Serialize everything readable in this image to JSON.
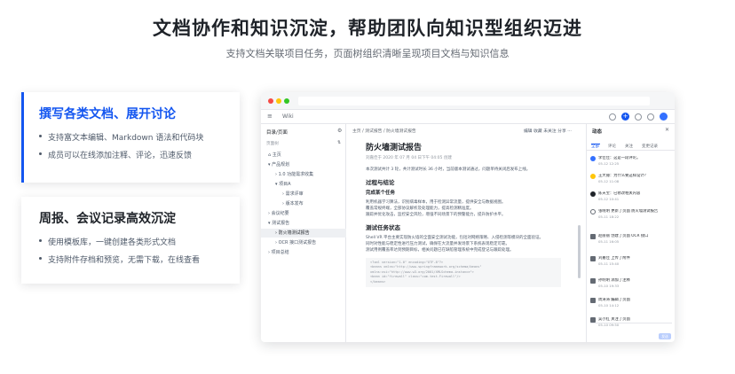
{
  "hero": {
    "title": "文档协作和知识沉淀，帮助团队向知识型组织迈进",
    "subtitle": "支持文档关联项目任务，页面树组织清晰呈现项目文档与知识信息"
  },
  "features": [
    {
      "title": "撰写各类文档、展开讨论",
      "items": [
        "支持富文本编辑、Markdown 语法和代码块",
        "成员可以在线添加注释、评论，迅速反馈"
      ]
    },
    {
      "title": "周报、会议记录高效沉淀",
      "items": [
        "使用模板库，一键创建各类形式文档",
        "支持附件存档和预览，无需下载，在线查看"
      ]
    }
  ],
  "app": {
    "title": "Wiki",
    "tree_header": "目录/页面",
    "tree_label": "页面树",
    "tree": [
      "主页",
      "产品规划",
      "1.0 功能需求收集",
      "项目A",
      "需求评审",
      "版本发布",
      "会议纪要",
      "测试报告",
      "防火墙测试报告",
      "OCR 接口测试报告",
      "项目总结"
    ],
    "breadcrumb": "主页 / 测试报告 / 防火墙测试报告",
    "doc_actions": "编辑  收藏  未关注  分享  ···",
    "doc": {
      "title": "防火墙测试报告",
      "meta": "刘嘉佳于 2020 年 07 月 04 日下午 04:05 创建",
      "intro": "本次测试共计 3 轮，共计测试时长 36 小时，当前版本测试通过，问题单待关闭后发布上线。",
      "h2a": "过程与结论",
      "h3": "完成某个任务",
      "p1": "利用机器学习算法，识别病毒样本，用于检测异常流量，提供安全与数据视图。",
      "p2": "覆盖常规终端，全部协议解析及处理能力，提高检测精准度。",
      "p3": "跟踪并优化攻击，监控安全风险，增强不同场景下的预警能力，提升防护水平。",
      "h2b": "测试任务状态",
      "p4": "Shell VR 平台主要实现防火墙的全面安全测试功能，包括对网络策略、入侵检测等模块的全面验证。",
      "p5": "同时对性能与稳定性进行压力测试，确保在大流量并发场景下系统表现稳定可靠。",
      "p6": "测试用例覆盖率达到预期目标，相关问题已在缺陷管理系统中完成登记与跟踪处理。",
      "code": [
        "<?xml version=\"1.0\" encoding=\"UTF-8\"?>",
        "<beans xmlns=\"http://www.springframework.org/schema/beans\"",
        "  xmlns:xsi=\"http://www.w3.org/2001/XMLSchema-instance\">",
        "  <bean id=\"firewall\" class=\"com.test.Firewall\"/>",
        "</beans>"
      ]
    },
    "panel": {
      "title": "动态",
      "tabs": [
        "全部",
        "评论",
        "关注",
        "变更记录"
      ],
      "entries": [
        {
          "text": "李佳佳：这是一段评论。",
          "time": "05-12 12:25"
        },
        {
          "text": "王大锤：为什么要这样设计？",
          "time": "05-12 11:08"
        },
        {
          "text": "陈天宝：已修改相关内容",
          "time": "05-12 10:41"
        },
        {
          "text": "张晓明 更新了页面 防火墙测试报告",
          "time": "05-11 18:22"
        },
        {
          "text": "赵丽丽 创建了页面 OCR 接口",
          "time": "05-11 16:05"
        },
        {
          "text": "刘嘉佳 上传了附件",
          "time": "05-11 15:40"
        },
        {
          "text": "孙明明 添加了注释",
          "time": "05-10 19:33"
        },
        {
          "text": "周涛涛 编辑了页面",
          "time": "05-10 14:12"
        },
        {
          "text": "吴小红 关注了页面",
          "time": "05-10 09:50"
        }
      ],
      "send": "发送"
    }
  }
}
